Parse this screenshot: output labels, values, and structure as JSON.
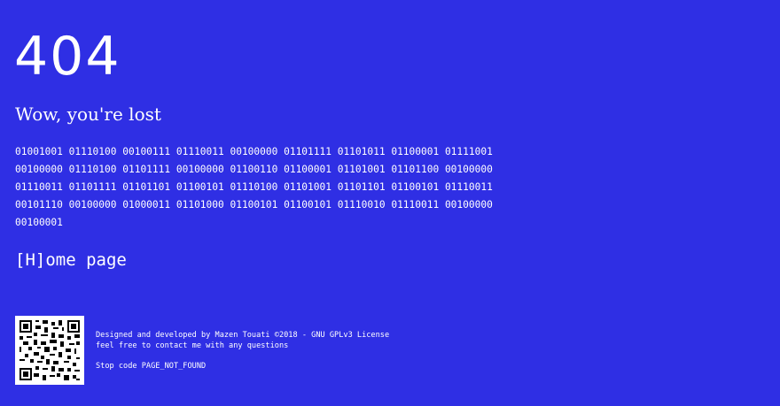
{
  "error": {
    "code": "404",
    "headline": "Wow, you're lost",
    "binary_lines": [
      "01001001 01110100 00100111 01110011 00100000 01101111 01101011 01100001 01111001",
      "00100000 01110100 01101111 00100000 01100110 01100001 01101001 01101100 00100000",
      "01110011 01101111 01101101 01100101 01110100 01101001 01101101 01100101 01110011",
      "00101110 00100000 01000011 01101000 01100101 01100101 01110010 01110011 00100000",
      "00100001"
    ]
  },
  "nav": {
    "home_label": "[H]ome page"
  },
  "footer": {
    "credit": "Designed and developed by Mazen Touati ©2018 - GNU GPLv3 License",
    "contact": "feel free to contact me with any questions",
    "stop_code": "Stop code PAGE_NOT_FOUND"
  },
  "qr": {
    "icon": "qr-code-icon"
  },
  "colors": {
    "background": "#2f2fe4",
    "text": "#ffffff"
  }
}
